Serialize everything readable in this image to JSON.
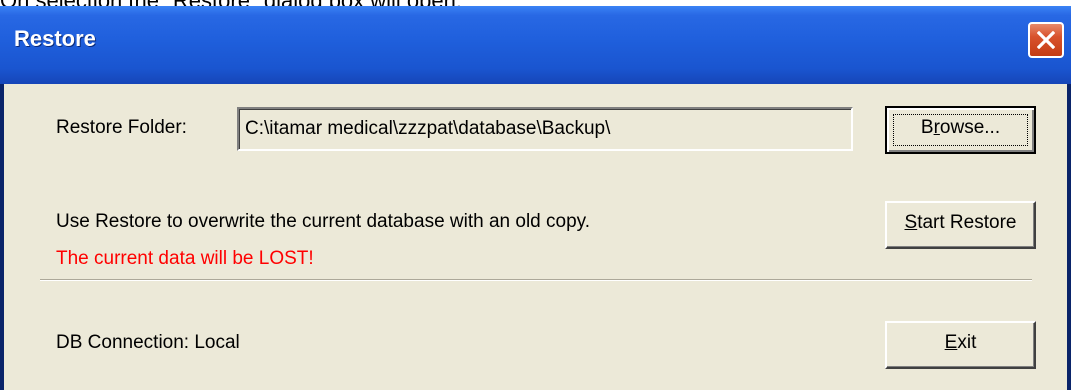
{
  "document": {
    "intro_text": "On selection the \"Restore\" dialog box will open:"
  },
  "dialog": {
    "title": "Restore",
    "close_icon": "close-x-icon",
    "restore_folder_label": "Restore Folder:",
    "restore_folder_value": "C:\\itamar medical\\zzzpat\\database\\Backup\\",
    "browse_button": {
      "label_pre": "B",
      "label_accel": "r",
      "label_post": "owse..."
    },
    "info_text": "Use Restore to overwrite the current database with an old copy.",
    "warning_text": "The current data will be LOST!",
    "start_restore_button": {
      "label_pre": "",
      "label_accel": "S",
      "label_post": "tart Restore"
    },
    "db_connection_text": "DB Connection: Local",
    "exit_button": {
      "label_pre": "",
      "label_accel": "E",
      "label_post": "xit"
    }
  },
  "colors": {
    "titlebar": "#1f5fdc",
    "dialog_bg": "#ece9d8",
    "warning": "#ff0000",
    "close_button": "#d8522c"
  }
}
